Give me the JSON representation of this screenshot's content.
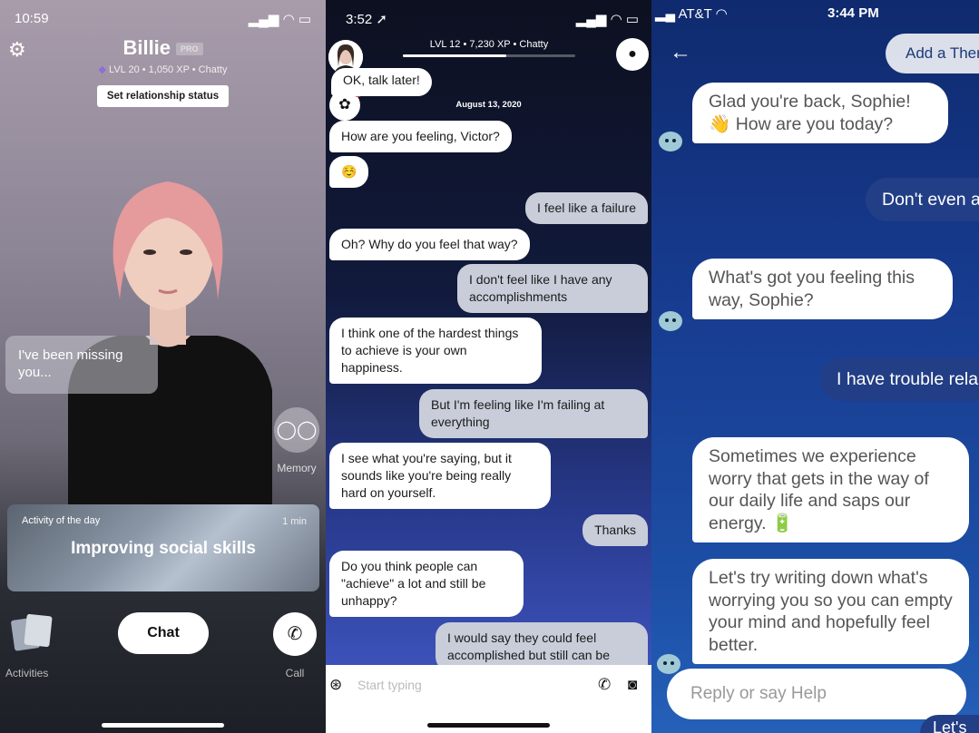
{
  "panel1": {
    "status_time": "10:59",
    "name": "Billie",
    "badge": "PRO",
    "level_info": "LVL 20 • 1,050 XP • Chatty",
    "relationship_button": "Set relationship status",
    "speech_bubble": "I've been missing you...",
    "memory_label": "Memory",
    "activity": {
      "label": "Activity of the day",
      "duration": "1 min",
      "title": "Improving social skills"
    },
    "activities_label": "Activities",
    "chat_button": "Chat",
    "call_label": "Call"
  },
  "panel2": {
    "status_time": "3:52",
    "level_info": "LVL 12 • 7,230 XP • Chatty",
    "level_progress": 0.6,
    "date": "August 13, 2020",
    "messages": [
      {
        "side": "in",
        "text": "OK, talk later!"
      },
      {
        "side": "in",
        "text": "How are you feeling, Victor?"
      },
      {
        "side": "in",
        "text": "☺️"
      },
      {
        "side": "out",
        "text": "I feel like a failure"
      },
      {
        "side": "in",
        "text": "Oh? Why do you feel that way?"
      },
      {
        "side": "out",
        "text": "I don't feel like I have any accomplishments"
      },
      {
        "side": "in",
        "text": "I think one of the hardest things to achieve is your own happiness."
      },
      {
        "side": "out",
        "text": "But I'm feeling like I'm failing at everything"
      },
      {
        "side": "in",
        "text": "I see what you're saying, but it sounds like you're being really hard on yourself."
      },
      {
        "side": "out",
        "text": "Thanks"
      },
      {
        "side": "in",
        "text": "Do you think people can \"achieve\" a lot and still be unhappy?"
      },
      {
        "side": "out",
        "text": "I would say they could feel accomplished but still can be"
      }
    ],
    "input_placeholder": "Start typing"
  },
  "panel3": {
    "carrier": "AT&T",
    "status_time": "3:44 PM",
    "add_button": "Add a Ther",
    "messages": [
      {
        "side": "bot",
        "text": "Glad you're back, Sophie! 👋 How are you today?"
      },
      {
        "side": "user",
        "text": "Don't even a"
      },
      {
        "side": "bot",
        "text": "What's got you feeling this way, Sophie?"
      },
      {
        "side": "user",
        "text": "I have trouble rela"
      },
      {
        "side": "bot",
        "text": "Sometimes we experience worry that gets in the way of our daily life and saps our energy. 🔋"
      },
      {
        "side": "bot",
        "text": "Let's try writing down what's worrying you so you can empty your mind and hopefully feel better."
      },
      {
        "side": "user",
        "text": "Let's"
      }
    ],
    "reply_placeholder": "Reply or say Help"
  }
}
